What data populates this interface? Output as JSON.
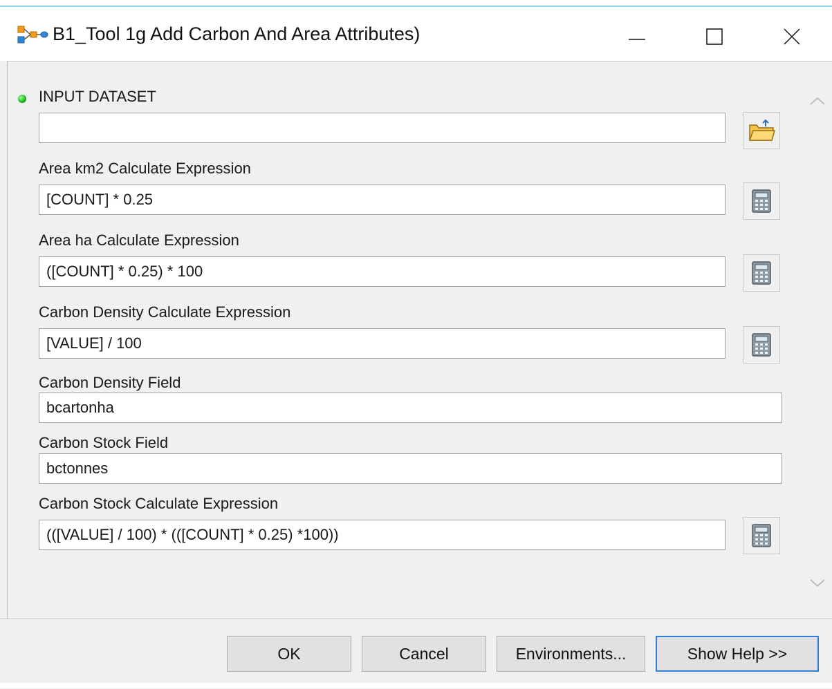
{
  "window": {
    "title": "B1_Tool 1g Add Carbon And Area Attributes)",
    "app_icon": "model-tool-icon",
    "controls": {
      "minimize_icon": "minimize-icon",
      "maximize_icon": "maximize-icon",
      "close_icon": "close-icon"
    }
  },
  "colors": {
    "required_indicator": "#19b319",
    "focus_border": "#2f7fd3",
    "folder_icon": "#f2c14e",
    "calculator_icon": "#6d7a86"
  },
  "parameters": [
    {
      "label": "INPUT DATASET",
      "value": "",
      "required": true,
      "button_icon": "browse-folder-icon"
    },
    {
      "label": "Area km2 Calculate Expression",
      "value": "[COUNT] * 0.25",
      "button_icon": "calculator-icon"
    },
    {
      "label": "Area ha Calculate Expression",
      "value": "([COUNT] * 0.25) * 100",
      "button_icon": "calculator-icon"
    },
    {
      "label": "Carbon Density Calculate Expression",
      "value": "[VALUE] / 100",
      "button_icon": "calculator-icon"
    },
    {
      "label": "Carbon Density Field",
      "value": "bcartonha"
    },
    {
      "label": "Carbon Stock Field",
      "value": "bctonnes"
    },
    {
      "label": "Carbon Stock Calculate Expression",
      "value": "(([VALUE] / 100) * (([COUNT] * 0.25) *100))",
      "button_icon": "calculator-icon"
    }
  ],
  "scrollbar": {
    "up_icon": "chevron-up-icon",
    "down_icon": "chevron-down-icon"
  },
  "buttons": {
    "ok": "OK",
    "cancel": "Cancel",
    "environments": "Environments...",
    "show_help": "Show Help >>"
  }
}
